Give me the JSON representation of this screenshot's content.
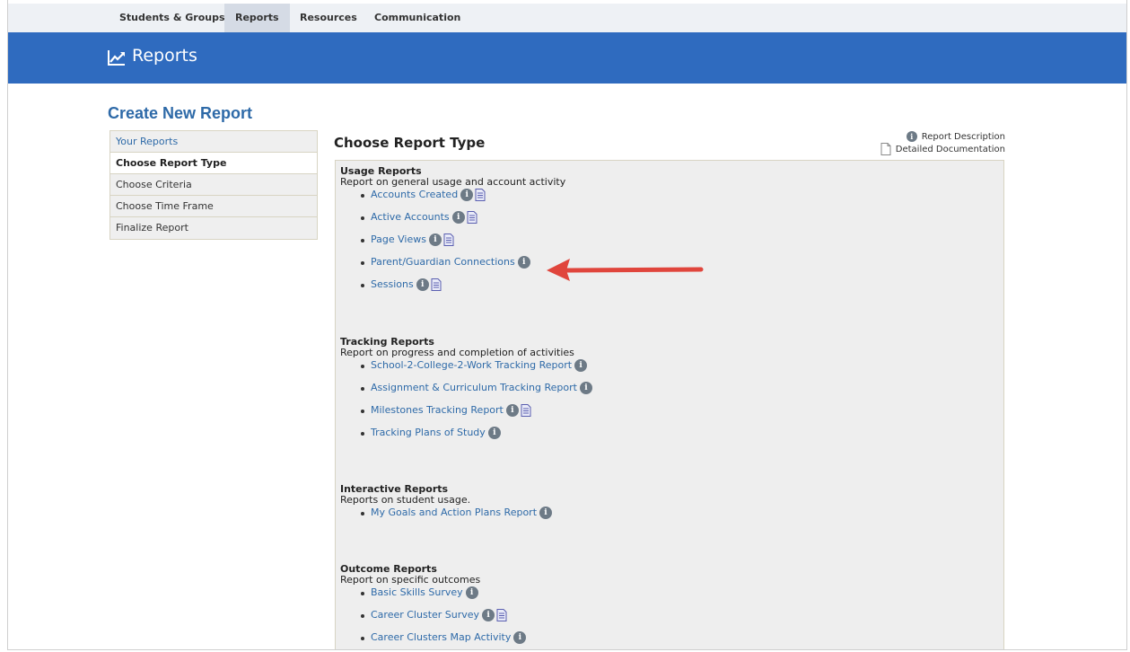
{
  "topnav": {
    "items": [
      {
        "label": "Students & Groups",
        "active": false
      },
      {
        "label": "Reports",
        "active": true
      },
      {
        "label": "Resources",
        "active": false
      },
      {
        "label": "Communication",
        "active": false
      }
    ]
  },
  "banner": {
    "title": "Reports",
    "icon": "line-chart-icon"
  },
  "create_title": "Create New Report",
  "steps": [
    {
      "label": "Your Reports",
      "state": "link"
    },
    {
      "label": "Choose Report Type",
      "state": "current"
    },
    {
      "label": "Choose Criteria",
      "state": "normal"
    },
    {
      "label": "Choose Time Frame",
      "state": "normal"
    },
    {
      "label": "Finalize Report",
      "state": "normal"
    }
  ],
  "main": {
    "title": "Choose Report Type",
    "legend": {
      "description": "Report Description",
      "documentation": "Detailed Documentation"
    }
  },
  "sections": [
    {
      "title": "Usage Reports",
      "desc": "Report on general usage and account activity",
      "items": [
        {
          "label": "Accounts Created",
          "doc": true
        },
        {
          "label": "Active Accounts",
          "doc": true
        },
        {
          "label": "Page Views",
          "doc": true
        },
        {
          "label": "Parent/Guardian Connections",
          "doc": false
        },
        {
          "label": "Sessions",
          "doc": true
        }
      ]
    },
    {
      "title": "Tracking Reports",
      "desc": "Report on progress and completion of activities",
      "items": [
        {
          "label": "School-2-College-2-Work Tracking Report",
          "doc": false
        },
        {
          "label": "Assignment & Curriculum Tracking Report",
          "doc": false
        },
        {
          "label": "Milestones Tracking Report",
          "doc": true
        },
        {
          "label": "Tracking Plans of Study",
          "doc": false
        }
      ]
    },
    {
      "title": "Interactive Reports",
      "desc": "Reports on student usage.",
      "items": [
        {
          "label": "My Goals and Action Plans Report",
          "doc": false
        }
      ]
    },
    {
      "title": "Outcome Reports",
      "desc": "Report on specific outcomes",
      "items": [
        {
          "label": "Basic Skills Survey",
          "doc": false
        },
        {
          "label": "Career Cluster Survey",
          "doc": true
        },
        {
          "label": "Career Clusters Map Activity",
          "doc": false
        }
      ]
    }
  ],
  "colors": {
    "banner": "#2f6bbf",
    "link": "#2e6aa8",
    "arrow": "#e0453c"
  }
}
